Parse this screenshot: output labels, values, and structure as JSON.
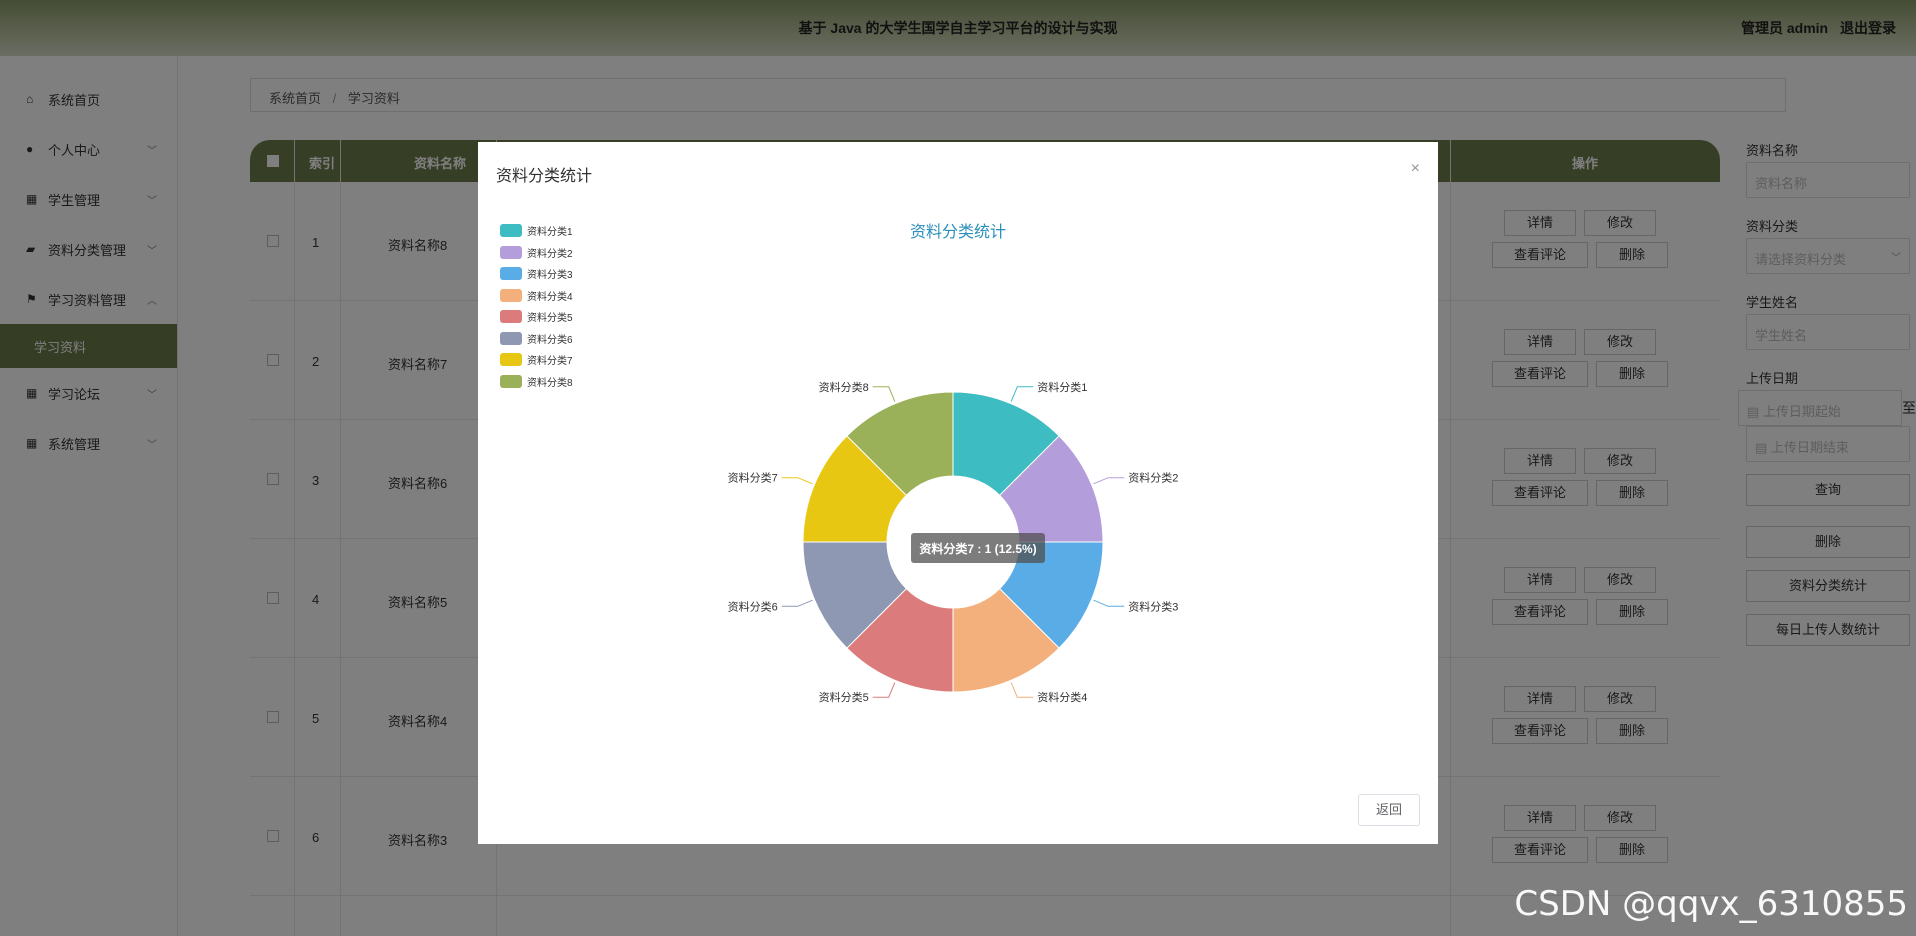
{
  "header": {
    "title": "基于 Java 的大学生国学自主学习平台的设计与实现",
    "user": "管理员 admin",
    "logout": "退出登录"
  },
  "sidebar": {
    "items": [
      {
        "label": "系统首页",
        "icon": "home-icon"
      },
      {
        "label": "个人中心",
        "icon": "user-icon"
      },
      {
        "label": "学生管理",
        "icon": "grid-icon"
      },
      {
        "label": "资料分类管理",
        "icon": "briefcase-icon"
      },
      {
        "label": "学习资料管理",
        "icon": "flag-icon"
      },
      {
        "label": "学习资料",
        "icon": ""
      },
      {
        "label": "学习论坛",
        "icon": "grid-icon"
      },
      {
        "label": "系统管理",
        "icon": "grid-icon"
      }
    ]
  },
  "breadcrumb": {
    "home": "系统首页",
    "current": "学习资料"
  },
  "table": {
    "headers": {
      "index": "索引",
      "name": "资料名称",
      "actions": "操作"
    },
    "rows": [
      {
        "index": "1",
        "name": "资料名称8"
      },
      {
        "index": "2",
        "name": "资料名称7"
      },
      {
        "index": "3",
        "name": "资料名称6"
      },
      {
        "index": "4",
        "name": "资料名称5"
      },
      {
        "index": "5",
        "name": "资料名称4"
      },
      {
        "index": "6",
        "name": "资料名称3"
      }
    ],
    "actions": {
      "detail": "详情",
      "edit": "修改",
      "comments": "查看评论",
      "delete": "删除"
    }
  },
  "panel": {
    "name_label": "资料名称",
    "name_placeholder": "资料名称",
    "category_label": "资料分类",
    "category_placeholder": "请选择资料分类",
    "student_label": "学生姓名",
    "student_placeholder": "学生姓名",
    "date_label": "上传日期",
    "date_start": "上传日期起始",
    "date_end": "上传日期结束",
    "date_to": "至",
    "search": "查询",
    "delete": "删除",
    "stats_category": "资料分类统计",
    "stats_daily": "每日上传人数统计"
  },
  "modal": {
    "title": "资料分类统计",
    "close": "×",
    "back": "返回"
  },
  "tooltip": "资料分类7 : 1 (12.5%)",
  "chart_data": {
    "type": "pie",
    "title": "资料分类统计",
    "categories": [
      "资料分类1",
      "资料分类2",
      "资料分类3",
      "资料分类4",
      "资料分类5",
      "资料分类6",
      "资料分类7",
      "资料分类8"
    ],
    "values": [
      1,
      1,
      1,
      1,
      1,
      1,
      1,
      1
    ],
    "colors": [
      "#3dbdc1",
      "#b39ddb",
      "#5aace6",
      "#f4b07c",
      "#dc7b7b",
      "#8e98b2",
      "#e8c713",
      "#9bb159"
    ],
    "legend": "top-left",
    "donut": true
  },
  "watermark": "CSDN @qqvx_6310855"
}
